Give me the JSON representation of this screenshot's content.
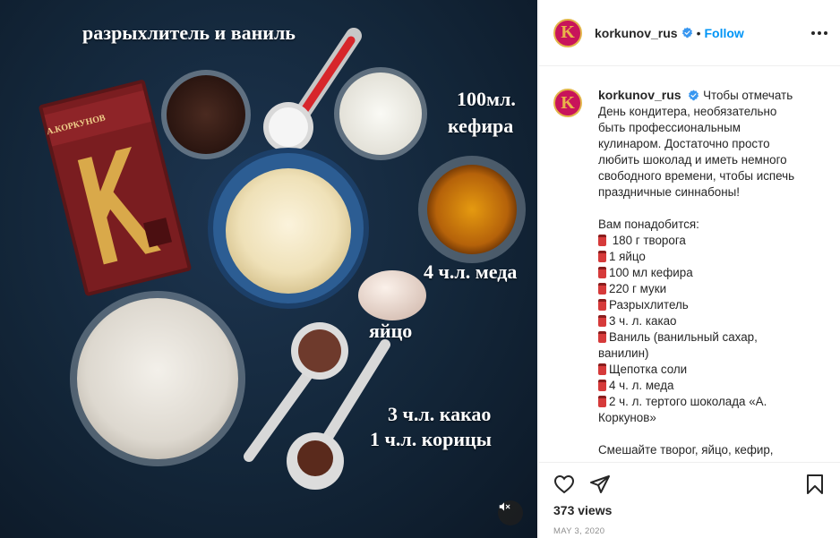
{
  "media": {
    "overlay": {
      "leavening": "разрыхлитель и ваниль",
      "kefir_line1": "100мл.",
      "kefir_line2": "кефира",
      "honey": "4 ч.л. меда",
      "egg": "яйцо",
      "cocoa": "3 ч.л. какао",
      "cinnamon": "1 ч.л. корицы"
    },
    "chocolate_brand": "А.КОРКУНОВ",
    "chocolate_letter": "K",
    "mute_icon": "speaker-muted-icon"
  },
  "header": {
    "avatar_letter": "K",
    "username": "korkunov_rus",
    "separator": "•",
    "follow_label": "Follow",
    "more_icon": "more-horizontal-icon"
  },
  "caption": {
    "avatar_letter": "K",
    "username": "korkunov_rus",
    "intro": [
      "Чтобы отмечать",
      "День кондитера, необязательно",
      "быть профессиональным",
      "кулинаром. Достаточно просто",
      "любить шоколад и иметь немного",
      "свободного времени, чтобы испечь",
      "праздничные синнабоны!"
    ],
    "ingredients_title": "Вам понадобится:",
    "ingredients": [
      " 180 г творога",
      "1 яйцо",
      "100 мл кефира",
      "220 г муки",
      "Разрыхлитель",
      "3 ч. л. какао",
      "Ваниль (ванильный сахар,",
      "ванилин)",
      "Щепотка соли",
      "4 ч. л. меда",
      "2 ч. л. тертого шоколада «А.",
      "Коркунов»"
    ],
    "ingredient_emoji": [
      true,
      true,
      true,
      true,
      true,
      true,
      true,
      false,
      true,
      true,
      true,
      false
    ],
    "method_start": "Смешайте творог, яйцо, кефир,"
  },
  "actions": {
    "icons": [
      "heart-icon",
      "share-icon",
      "bookmark-icon"
    ],
    "views": "373 views",
    "date": "MAY 3, 2020"
  },
  "colors": {
    "brand": "#c8145a",
    "brand_gold": "#e2b54b",
    "follow": "#0095f6",
    "verified": "#3897f0",
    "background_media": "#132639"
  }
}
